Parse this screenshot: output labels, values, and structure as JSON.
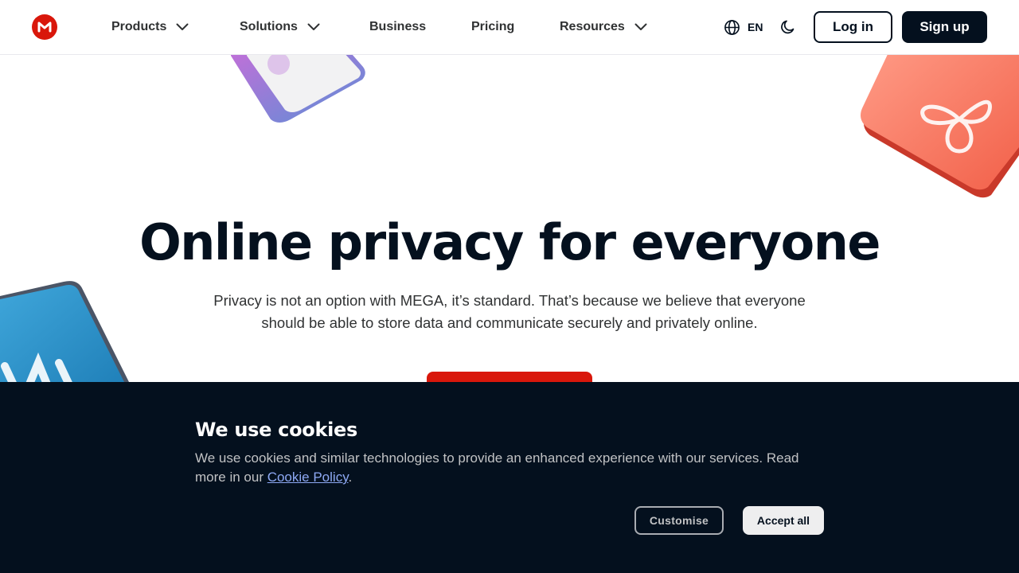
{
  "header": {
    "logo_alt": "MEGA",
    "nav": [
      {
        "label": "Products",
        "has_dropdown": true
      },
      {
        "label": "Solutions",
        "has_dropdown": true
      },
      {
        "label": "Business",
        "has_dropdown": false
      },
      {
        "label": "Pricing",
        "has_dropdown": false
      },
      {
        "label": "Resources",
        "has_dropdown": true
      }
    ],
    "language": "EN",
    "login_label": "Log in",
    "signup_label": "Sign up"
  },
  "hero": {
    "title": "Online privacy for everyone",
    "subtitle_line1": "Privacy is not an option with MEGA, it’s standard. That’s because we believe that everyone",
    "subtitle_line2": "should be able to store data and communicate securely and privately online."
  },
  "cookie_banner": {
    "title": "We use cookies",
    "text_before_link": "We use cookies and similar technologies to provide an enhanced experience with our services. Read more in our ",
    "link_text": "Cookie Policy",
    "text_after_link": ".",
    "customise_label": "Customise",
    "accept_label": "Accept all"
  },
  "colors": {
    "brand_red": "#d9170b",
    "navy": "#04101e",
    "link_blue": "#8ea9f4"
  },
  "icons": {
    "logo": "mega-logo-icon",
    "dropdown": "chevron-down-icon",
    "language": "globe-icon",
    "theme": "moon-icon"
  }
}
